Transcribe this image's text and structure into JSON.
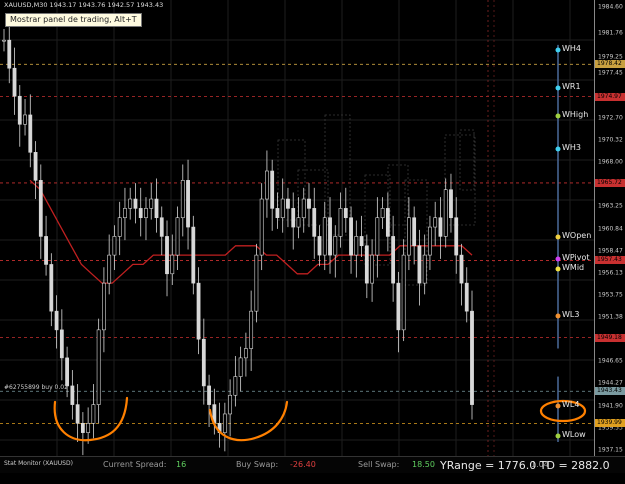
{
  "window": {
    "title": "XAUUSD,M30  1943.17 1943.76 1942.57 1943.43",
    "tooltip": "Mostrar panel de trading, Alt+T"
  },
  "chart_data": {
    "type": "candlestick",
    "symbol": "XAUUSD",
    "timeframe": "M30",
    "ylim": [
      1936.5,
      1985.3
    ],
    "y_ticks": [
      1984.6,
      1981.76,
      1979.25,
      1977.45,
      1975.07,
      1972.7,
      1970.32,
      1968.0,
      1965.58,
      1963.25,
      1960.84,
      1958.47,
      1956.13,
      1953.75,
      1951.38,
      1949.0,
      1946.65,
      1944.27,
      1941.9,
      1939.53,
      1937.15
    ],
    "price_labels": [
      {
        "value": "1978.42",
        "color": "#c8a040"
      },
      {
        "value": "1974.97",
        "color": "#c83030"
      },
      {
        "value": "1965.72",
        "color": "#c83030"
      },
      {
        "value": "1957.43",
        "color": "#c83030"
      },
      {
        "value": "1949.18",
        "color": "#c83030"
      },
      {
        "value": "1943.43",
        "color": "#7a9aa0"
      },
      {
        "value": "1939.99",
        "color": "#e0a020"
      }
    ],
    "close_approx": [
      1981,
      1978,
      1975,
      1972,
      1973,
      1969,
      1966,
      1960,
      1957,
      1952,
      1950,
      1947,
      1944,
      1942,
      1940,
      1939,
      1940,
      1942,
      1950,
      1955,
      1958,
      1960,
      1962,
      1963,
      1964,
      1963,
      1962,
      1963,
      1964,
      1962,
      1960,
      1956,
      1958,
      1962,
      1966,
      1961,
      1955,
      1949,
      1944,
      1942,
      1940,
      1939,
      1941,
      1943,
      1945,
      1947,
      1948,
      1952,
      1958,
      1964,
      1967,
      1963,
      1962,
      1964,
      1963,
      1961,
      1962,
      1964,
      1963,
      1960,
      1958,
      1962,
      1958,
      1960,
      1963,
      1962,
      1958,
      1960,
      1959,
      1955,
      1958,
      1962,
      1963,
      1960,
      1955,
      1950,
      1958,
      1962,
      1959,
      1955,
      1958,
      1961,
      1962,
      1960,
      1965,
      1962,
      1958,
      1955,
      1952,
      1942
    ],
    "ma_approx": [
      1966,
      1965,
      1963,
      1961,
      1959,
      1957,
      1956,
      1955,
      1955,
      1956,
      1957,
      1957,
      1958,
      1958,
      1958,
      1958,
      1958,
      1958,
      1958,
      1958,
      1959,
      1959,
      1959,
      1958,
      1958,
      1957,
      1956,
      1956,
      1957,
      1957,
      1958,
      1958,
      1958,
      1958,
      1958,
      1958,
      1959,
      1959,
      1959,
      1959,
      1959,
      1959,
      1959,
      1958
    ],
    "grid": true
  },
  "pivots": [
    {
      "label": "WH4",
      "value": 1979.9,
      "color": "#40d0f0"
    },
    {
      "label": "WR1",
      "value": 1975.9,
      "color": "#40d0f0"
    },
    {
      "label": "WHigh",
      "value": 1972.9,
      "color": "#a0d040"
    },
    {
      "label": "WH3",
      "value": 1969.4,
      "color": "#40d0f0"
    },
    {
      "label": "WOpen",
      "value": 1959.9,
      "color": "#f0d040"
    },
    {
      "label": "WPivot",
      "value": 1957.6,
      "color": "#d040f0"
    },
    {
      "label": "WMid",
      "value": 1956.5,
      "color": "#f0e040"
    },
    {
      "label": "WL3",
      "value": 1951.5,
      "color": "#f09030"
    },
    {
      "label": "WL4",
      "value": 1941.9,
      "color": "#f09030"
    },
    {
      "label": "WLow",
      "value": 1938.6,
      "color": "#a0d040"
    }
  ],
  "order_label": "#62755899 buy 0.02",
  "status": {
    "title": "Stat Monitor (XAUUSD)",
    "spread_label": "Current Spread:",
    "spread_value": "16",
    "buy_swap_label": "Buy Swap:",
    "buy_swap_value": "-26.40",
    "sell_swap_label": "Sell Swap:",
    "sell_swap_value": "18.50",
    "extra_value": "1.04",
    "yrange": "YRange = 1776.0   TD = 2882.0"
  },
  "colors": {
    "candles": "#d8d8d8",
    "ma": "#c02020",
    "grid": "#262626",
    "annotation": "#ff8000",
    "red_level": "#c83030",
    "yellow_level": "#c8a040"
  }
}
